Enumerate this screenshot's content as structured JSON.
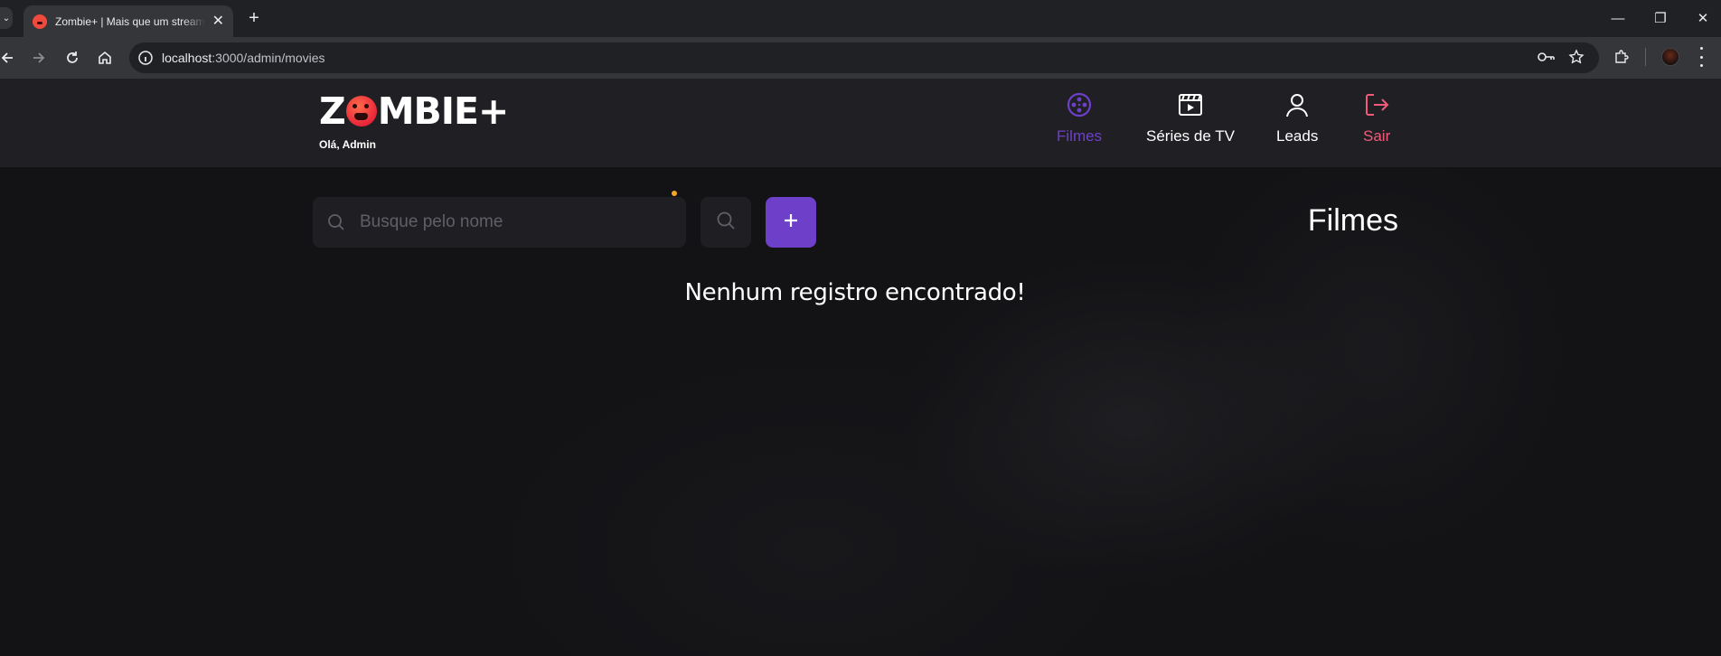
{
  "browser": {
    "tab_title": "Zombie+ | Mais que um streaming",
    "tab_close": "✕",
    "new_tab": "+",
    "url_host": "localhost",
    "url_path": ":3000/admin/movies",
    "controls": {
      "minimize": "—",
      "restore": "❐",
      "close": "✕"
    }
  },
  "header": {
    "logo_left": "Z",
    "logo_right": "MBIE+",
    "greeting": "Olá, Admin",
    "nav": [
      {
        "label": "Filmes",
        "icon": "film-reel-icon",
        "color": "#6e3fc9",
        "active": true
      },
      {
        "label": "Séries de TV",
        "icon": "clapperboard-icon",
        "color": "#ffffff",
        "active": false
      },
      {
        "label": "Leads",
        "icon": "user-icon",
        "color": "#ffffff",
        "active": false
      },
      {
        "label": "Sair",
        "icon": "logout-icon",
        "color": "#f25a7a",
        "active": false
      }
    ]
  },
  "main": {
    "search_placeholder": "Busque pelo nome",
    "add_label": "+",
    "page_title": "Filmes",
    "empty_message": "Nenhum registro encontrado!"
  },
  "colors": {
    "accent": "#6e3fc9",
    "logout": "#f25a7a",
    "notification_dot": "#f5a623"
  }
}
